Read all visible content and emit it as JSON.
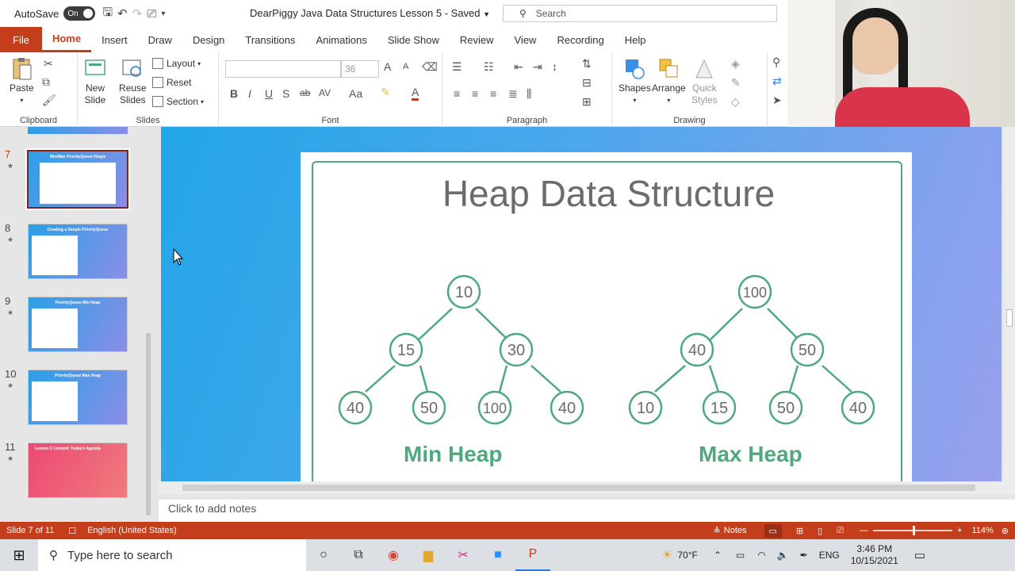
{
  "titlebar": {
    "autosave_label": "AutoSave",
    "autosave_state": "On",
    "doc_title": "DearPiggy Java Data Structures Lesson 5",
    "save_status": "Saved",
    "search_placeholder": "Search"
  },
  "tabs": [
    "File",
    "Home",
    "Insert",
    "Draw",
    "Design",
    "Transitions",
    "Animations",
    "Slide Show",
    "Review",
    "View",
    "Recording",
    "Help"
  ],
  "ribbon": {
    "clipboard": {
      "label": "Clipboard",
      "paste": "Paste"
    },
    "slides": {
      "label": "Slides",
      "new_slide_1": "New",
      "new_slide_2": "Slide",
      "reuse_1": "Reuse",
      "reuse_2": "Slides",
      "layout": "Layout",
      "reset": "Reset",
      "section": "Section"
    },
    "font": {
      "label": "Font",
      "font_name": "",
      "font_size": "36"
    },
    "paragraph": {
      "label": "Paragraph"
    },
    "drawing": {
      "label": "Drawing",
      "shapes": "Shapes",
      "arrange": "Arrange",
      "quick_1": "Quick",
      "quick_2": "Styles"
    }
  },
  "thumbnails": [
    {
      "num": "7",
      "title": "Min/Max PriorityQueue Heaps",
      "selected": true
    },
    {
      "num": "8",
      "title": "Creating a Simple PriorityQueue",
      "selected": false
    },
    {
      "num": "9",
      "title": "PriorityQueue Min Heap",
      "selected": false
    },
    {
      "num": "10",
      "title": "PriorityQueue Max Heap",
      "selected": false
    },
    {
      "num": "11",
      "title": "Lesson 5 Content: Today's Agenda",
      "selected": false
    }
  ],
  "slide": {
    "title": "Heap Data Structure",
    "min_heap": {
      "label": "Min Heap",
      "nodes": [
        "10",
        "15",
        "30",
        "40",
        "50",
        "100",
        "40"
      ]
    },
    "max_heap": {
      "label": "Max Heap",
      "nodes": [
        "100",
        "40",
        "50",
        "10",
        "15",
        "50",
        "40"
      ]
    }
  },
  "notes_placeholder": "Click to add notes",
  "status": {
    "slide_count": "Slide 7 of 11",
    "language": "English (United States)",
    "notes": "Notes",
    "zoom": "114%"
  },
  "taskbar": {
    "search_placeholder": "Type here to search",
    "temperature": "70°F",
    "lang": "ENG",
    "time": "3:46 PM",
    "date": "10/15/2021"
  }
}
